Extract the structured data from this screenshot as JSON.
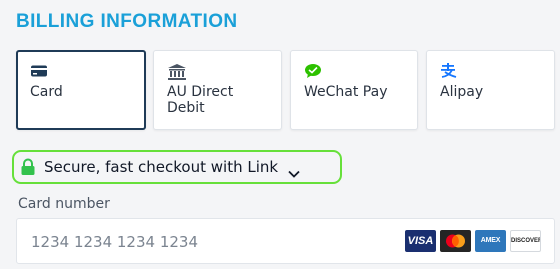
{
  "section": {
    "title": "BILLING INFORMATION"
  },
  "payment_methods": {
    "selected": "Card",
    "tabs": [
      {
        "label": "Card",
        "icon": "card-icon"
      },
      {
        "label": "AU Direct Debit",
        "icon": "bank-icon"
      },
      {
        "label": "WeChat Pay",
        "icon": "wechat-icon"
      },
      {
        "label": "Alipay",
        "icon": "alipay-icon"
      }
    ]
  },
  "link": {
    "text": "Secure, fast checkout with Link",
    "icon": "lock-icon",
    "accent_color": "#66e03a"
  },
  "card_number": {
    "label": "Card number",
    "placeholder": "1234 1234 1234 1234",
    "brands": [
      "VISA",
      "Mastercard",
      "AMEX",
      "DISCOVER"
    ]
  },
  "colors": {
    "title": "#1aa0d8",
    "selected_border": "#1f3b57",
    "link_green": "#66e03a"
  }
}
